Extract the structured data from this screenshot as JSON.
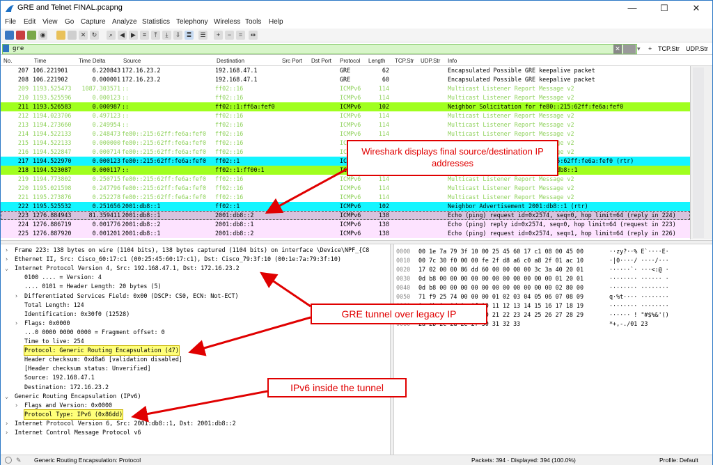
{
  "window": {
    "title": "GRE and Telnet FINAL.pcapng",
    "minimize": "—",
    "maximize": "☐",
    "close": "✕"
  },
  "menu": [
    "File",
    "Edit",
    "View",
    "Go",
    "Capture",
    "Analyze",
    "Statistics",
    "Telephony",
    "Wireless",
    "Tools",
    "Help"
  ],
  "filter": {
    "value": "gre",
    "buttons": [
      "+",
      "TCP.Str",
      "UDP.Str"
    ]
  },
  "columns": [
    "No.",
    "Time",
    "Time Delta",
    "Source",
    "Destination",
    "Src Port",
    "Dst Port",
    "Protocol",
    "Length",
    "TCP.Str",
    "UDP.Str",
    "Info"
  ],
  "packets": [
    {
      "no": "207",
      "time": "106.221901",
      "delta": "6.220843",
      "src": "172.16.23.2",
      "dst": "192.168.47.1",
      "proto": "GRE",
      "len": "62",
      "info": "Encapsulated Possible GRE keepalive packet",
      "style": "normal"
    },
    {
      "no": "208",
      "time": "106.221902",
      "delta": "0.000001",
      "src": "172.16.23.2",
      "dst": "192.168.47.1",
      "proto": "GRE",
      "len": "60",
      "info": "Encapsulated Possible GRE keepalive packet",
      "style": "normal"
    },
    {
      "no": "209",
      "time": "1193.525473",
      "delta": "1087.303571",
      "src": "::",
      "dst": "ff02::16",
      "proto": "ICMPv6",
      "len": "114",
      "info": "Multicast Listener Report Message v2",
      "style": "faded"
    },
    {
      "no": "210",
      "time": "1193.525596",
      "delta": "0.000123",
      "src": "::",
      "dst": "ff02::16",
      "proto": "ICMPv6",
      "len": "114",
      "info": "Multicast Listener Report Message v2",
      "style": "faded"
    },
    {
      "no": "211",
      "time": "1193.526583",
      "delta": "0.000987",
      "src": "::",
      "dst": "ff02::1:ff6a:fef0",
      "proto": "ICMPv6",
      "len": "102",
      "info": "Neighbor Solicitation for fe80::215:62ff:fe6a:fef0",
      "style": "green"
    },
    {
      "no": "212",
      "time": "1194.023706",
      "delta": "0.497123",
      "src": "::",
      "dst": "ff02::16",
      "proto": "ICMPv6",
      "len": "114",
      "info": "Multicast Listener Report Message v2",
      "style": "faded"
    },
    {
      "no": "213",
      "time": "1194.273660",
      "delta": "0.249954",
      "src": "::",
      "dst": "ff02::16",
      "proto": "ICMPv6",
      "len": "114",
      "info": "Multicast Listener Report Message v2",
      "style": "faded"
    },
    {
      "no": "214",
      "time": "1194.522133",
      "delta": "0.248473",
      "src": "fe80::215:62ff:fe6a:fef0",
      "dst": "ff02::16",
      "proto": "ICMPv6",
      "len": "114",
      "info": "Multicast Listener Report Message v2",
      "style": "faded"
    },
    {
      "no": "215",
      "time": "1194.522133",
      "delta": "0.000000",
      "src": "fe80::215:62ff:fe6a:fef0",
      "dst": "ff02::16",
      "proto": "ICMPv6",
      "len": "114",
      "info": "Multicast Listener Report Message v2",
      "style": "faded"
    },
    {
      "no": "216",
      "time": "1194.522847",
      "delta": "0.000714",
      "src": "fe80::215:62ff:fe6a:fef0",
      "dst": "ff02::16",
      "proto": "ICMPv6",
      "len": "114",
      "info": "Multicast Listener Report Message v2",
      "style": "faded"
    },
    {
      "no": "217",
      "time": "1194.522970",
      "delta": "0.000123",
      "src": "fe80::215:62ff:fe6a:fef0",
      "dst": "ff02::1",
      "proto": "ICMPv6",
      "len": "102",
      "info": "Neighbor Advertisement fe80::215:62ff:fe6a:fef0 (rtr)",
      "style": "cyan"
    },
    {
      "no": "218",
      "time": "1194.523087",
      "delta": "0.000117",
      "src": "::",
      "dst": "ff02::1:ff00:1",
      "proto": "ICMPv6",
      "len": "102",
      "info": "Neighbor Solicitation for 2001:db8::1",
      "style": "green"
    },
    {
      "no": "219",
      "time": "1194.773802",
      "delta": "0.250715",
      "src": "fe80::215:62ff:fe6a:fef0",
      "dst": "ff02::16",
      "proto": "ICMPv6",
      "len": "114",
      "info": "Multicast Listener Report Message v2",
      "style": "faded"
    },
    {
      "no": "220",
      "time": "1195.021598",
      "delta": "0.247796",
      "src": "fe80::215:62ff:fe6a:fef0",
      "dst": "ff02::16",
      "proto": "ICMPv6",
      "len": "114",
      "info": "Multicast Listener Report Message v2",
      "style": "faded"
    },
    {
      "no": "221",
      "time": "1195.273876",
      "delta": "0.252278",
      "src": "fe80::215:62ff:fe6a:fef0",
      "dst": "ff02::16",
      "proto": "ICMPv6",
      "len": "114",
      "info": "Multicast Listener Report Message v2",
      "style": "faded"
    },
    {
      "no": "222",
      "time": "1195.525532",
      "delta": "0.251656",
      "src": "2001:db8::1",
      "dst": "ff02::1",
      "proto": "ICMPv6",
      "len": "102",
      "info": "Neighbor Advertisement 2001:db8::1 (rtr)",
      "style": "cyan"
    },
    {
      "no": "223",
      "time": "1276.884943",
      "delta": "81.359411",
      "src": "2001:db8::1",
      "dst": "2001:db8::2",
      "proto": "ICMPv6",
      "len": "138",
      "info": "Echo (ping) request id=0x2574, seq=0, hop limit=64 (reply in 224)",
      "style": "selected"
    },
    {
      "no": "224",
      "time": "1276.886719",
      "delta": "0.001776",
      "src": "2001:db8::2",
      "dst": "2001:db8::1",
      "proto": "ICMPv6",
      "len": "138",
      "info": "Echo (ping) reply id=0x2574, seq=0, hop limit=64 (request in 223)",
      "style": "pink"
    },
    {
      "no": "225",
      "time": "1276.887920",
      "delta": "0.001201",
      "src": "2001:db8::1",
      "dst": "2001:db8::2",
      "proto": "ICMPv6",
      "len": "138",
      "info": "Echo (ping) request id=0x2574, seq=1, hop limit=64 (reply in 226)",
      "style": "pink"
    }
  ],
  "details": [
    {
      "text": "Frame 223: 138 bytes on wire (1104 bits), 138 bytes captured (1104 bits) on interface \\Device\\NPF_{C8",
      "indent": 0,
      "arrow": ">",
      "hl": false
    },
    {
      "text": "Ethernet II, Src: Cisco_60:17:c1 (00:25:45:60:17:c1), Dst: Cisco_79:3f:10 (00:1e:7a:79:3f:10)",
      "indent": 0,
      "arrow": ">",
      "hl": false
    },
    {
      "text": "Internet Protocol Version 4, Src: 192.168.47.1, Dst: 172.16.23.2",
      "indent": 0,
      "arrow": "v",
      "hl": false
    },
    {
      "text": "0100 .... = Version: 4",
      "indent": 1,
      "arrow": "",
      "hl": false
    },
    {
      "text": ".... 0101 = Header Length: 20 bytes (5)",
      "indent": 1,
      "arrow": "",
      "hl": false
    },
    {
      "text": "Differentiated Services Field: 0x00 (DSCP: CS0, ECN: Not-ECT)",
      "indent": 1,
      "arrow": ">",
      "hl": false
    },
    {
      "text": "Total Length: 124",
      "indent": 1,
      "arrow": "",
      "hl": false
    },
    {
      "text": "Identification: 0x30f0 (12528)",
      "indent": 1,
      "arrow": "",
      "hl": false
    },
    {
      "text": "Flags: 0x0000",
      "indent": 1,
      "arrow": ">",
      "hl": false
    },
    {
      "text": "...0 0000 0000 0000 = Fragment offset: 0",
      "indent": 1,
      "arrow": "",
      "hl": false
    },
    {
      "text": "Time to live: 254",
      "indent": 1,
      "arrow": "",
      "hl": false
    },
    {
      "text": "Protocol: Generic Routing Encapsulation (47)",
      "indent": 1,
      "arrow": "",
      "hl": true
    },
    {
      "text": "Header checksum: 0xd8a6 [validation disabled]",
      "indent": 1,
      "arrow": "",
      "hl": false
    },
    {
      "text": "[Header checksum status: Unverified]",
      "indent": 1,
      "arrow": "",
      "hl": false
    },
    {
      "text": "Source: 192.168.47.1",
      "indent": 1,
      "arrow": "",
      "hl": false
    },
    {
      "text": "Destination: 172.16.23.2",
      "indent": 1,
      "arrow": "",
      "hl": false
    },
    {
      "text": "Generic Routing Encapsulation (IPv6)",
      "indent": 0,
      "arrow": "v",
      "hl": false
    },
    {
      "text": "Flags and Version: 0x0000",
      "indent": 1,
      "arrow": ">",
      "hl": false
    },
    {
      "text": "Protocol Type: IPv6 (0x86dd)",
      "indent": 1,
      "arrow": "",
      "hl": true
    },
    {
      "text": "Internet Protocol Version 6, Src: 2001:db8::1, Dst: 2001:db8::2",
      "indent": 0,
      "arrow": ">",
      "hl": false
    },
    {
      "text": "Internet Control Message Protocol v6",
      "indent": 0,
      "arrow": ">",
      "hl": false
    }
  ],
  "bytes": [
    {
      "off": "0000",
      "hex": "00 1e 7a 79 3f 10 00 25  45 60 17 c1 08 00 45 00",
      "asc": "··zy?··% E`····E·"
    },
    {
      "off": "0010",
      "hex": "00 7c 30 f0 00 00 fe 2f  d8 a6 c0 a8 2f 01 ac 10",
      "asc": "·|0····/ ····/···"
    },
    {
      "off": "0020",
      "hex": "17 02 00 00 86 dd 60 00  00 00 00 3c 3a 40 20 01",
      "asc": "······`· ···<:@ ·"
    },
    {
      "off": "0030",
      "hex": "0d b8 00 00 00 00 00 00  00 00 00 00 00 01 20 01",
      "asc": "········ ······ ·"
    },
    {
      "off": "0040",
      "hex": "0d b8 00 00 00 00 00 00  00 00 00 00 00 02 80 00",
      "asc": "········ ········"
    },
    {
      "off": "0050",
      "hex": "71 f9 25 74 00 00 00 01  02 03 04 05 06 07 08 09",
      "asc": "q·%t···· ········"
    },
    {
      "off": "0060",
      "hex": "0a 0b 0c 0d 0e 0f 10 11  12 13 14 15 16 17 18 19",
      "asc": "········ ········"
    },
    {
      "off": "0070",
      "hex": "1a 1b 1c 1d 1e 1f 20 21  22 23 24 25 26 27 28 29",
      "asc": "······ ! \"#$%&'()"
    },
    {
      "off": "0080",
      "hex": "2a 2b 2c 2d 2e 2f 30 31  32 33",
      "asc": "*+,-./01 23"
    }
  ],
  "status": {
    "field": "Generic Routing Encapsulation: Protocol",
    "packets": "Packets: 394 · Displayed: 394 (100.0%)",
    "profile": "Profile: Default"
  },
  "callouts": {
    "c1": "Wireshark displays final source/destination IP addresses",
    "c2": "GRE tunnel over legacy IP",
    "c3": "IPv6 inside the tunnel"
  },
  "colors": {
    "green": "#a0ff1e",
    "cyan": "#14f5ff",
    "faded": "#8ed15a",
    "selected": "#d7c2dd",
    "pink": "#fde3ff",
    "callout": "#e00000",
    "highlight": "#ffff7a"
  }
}
